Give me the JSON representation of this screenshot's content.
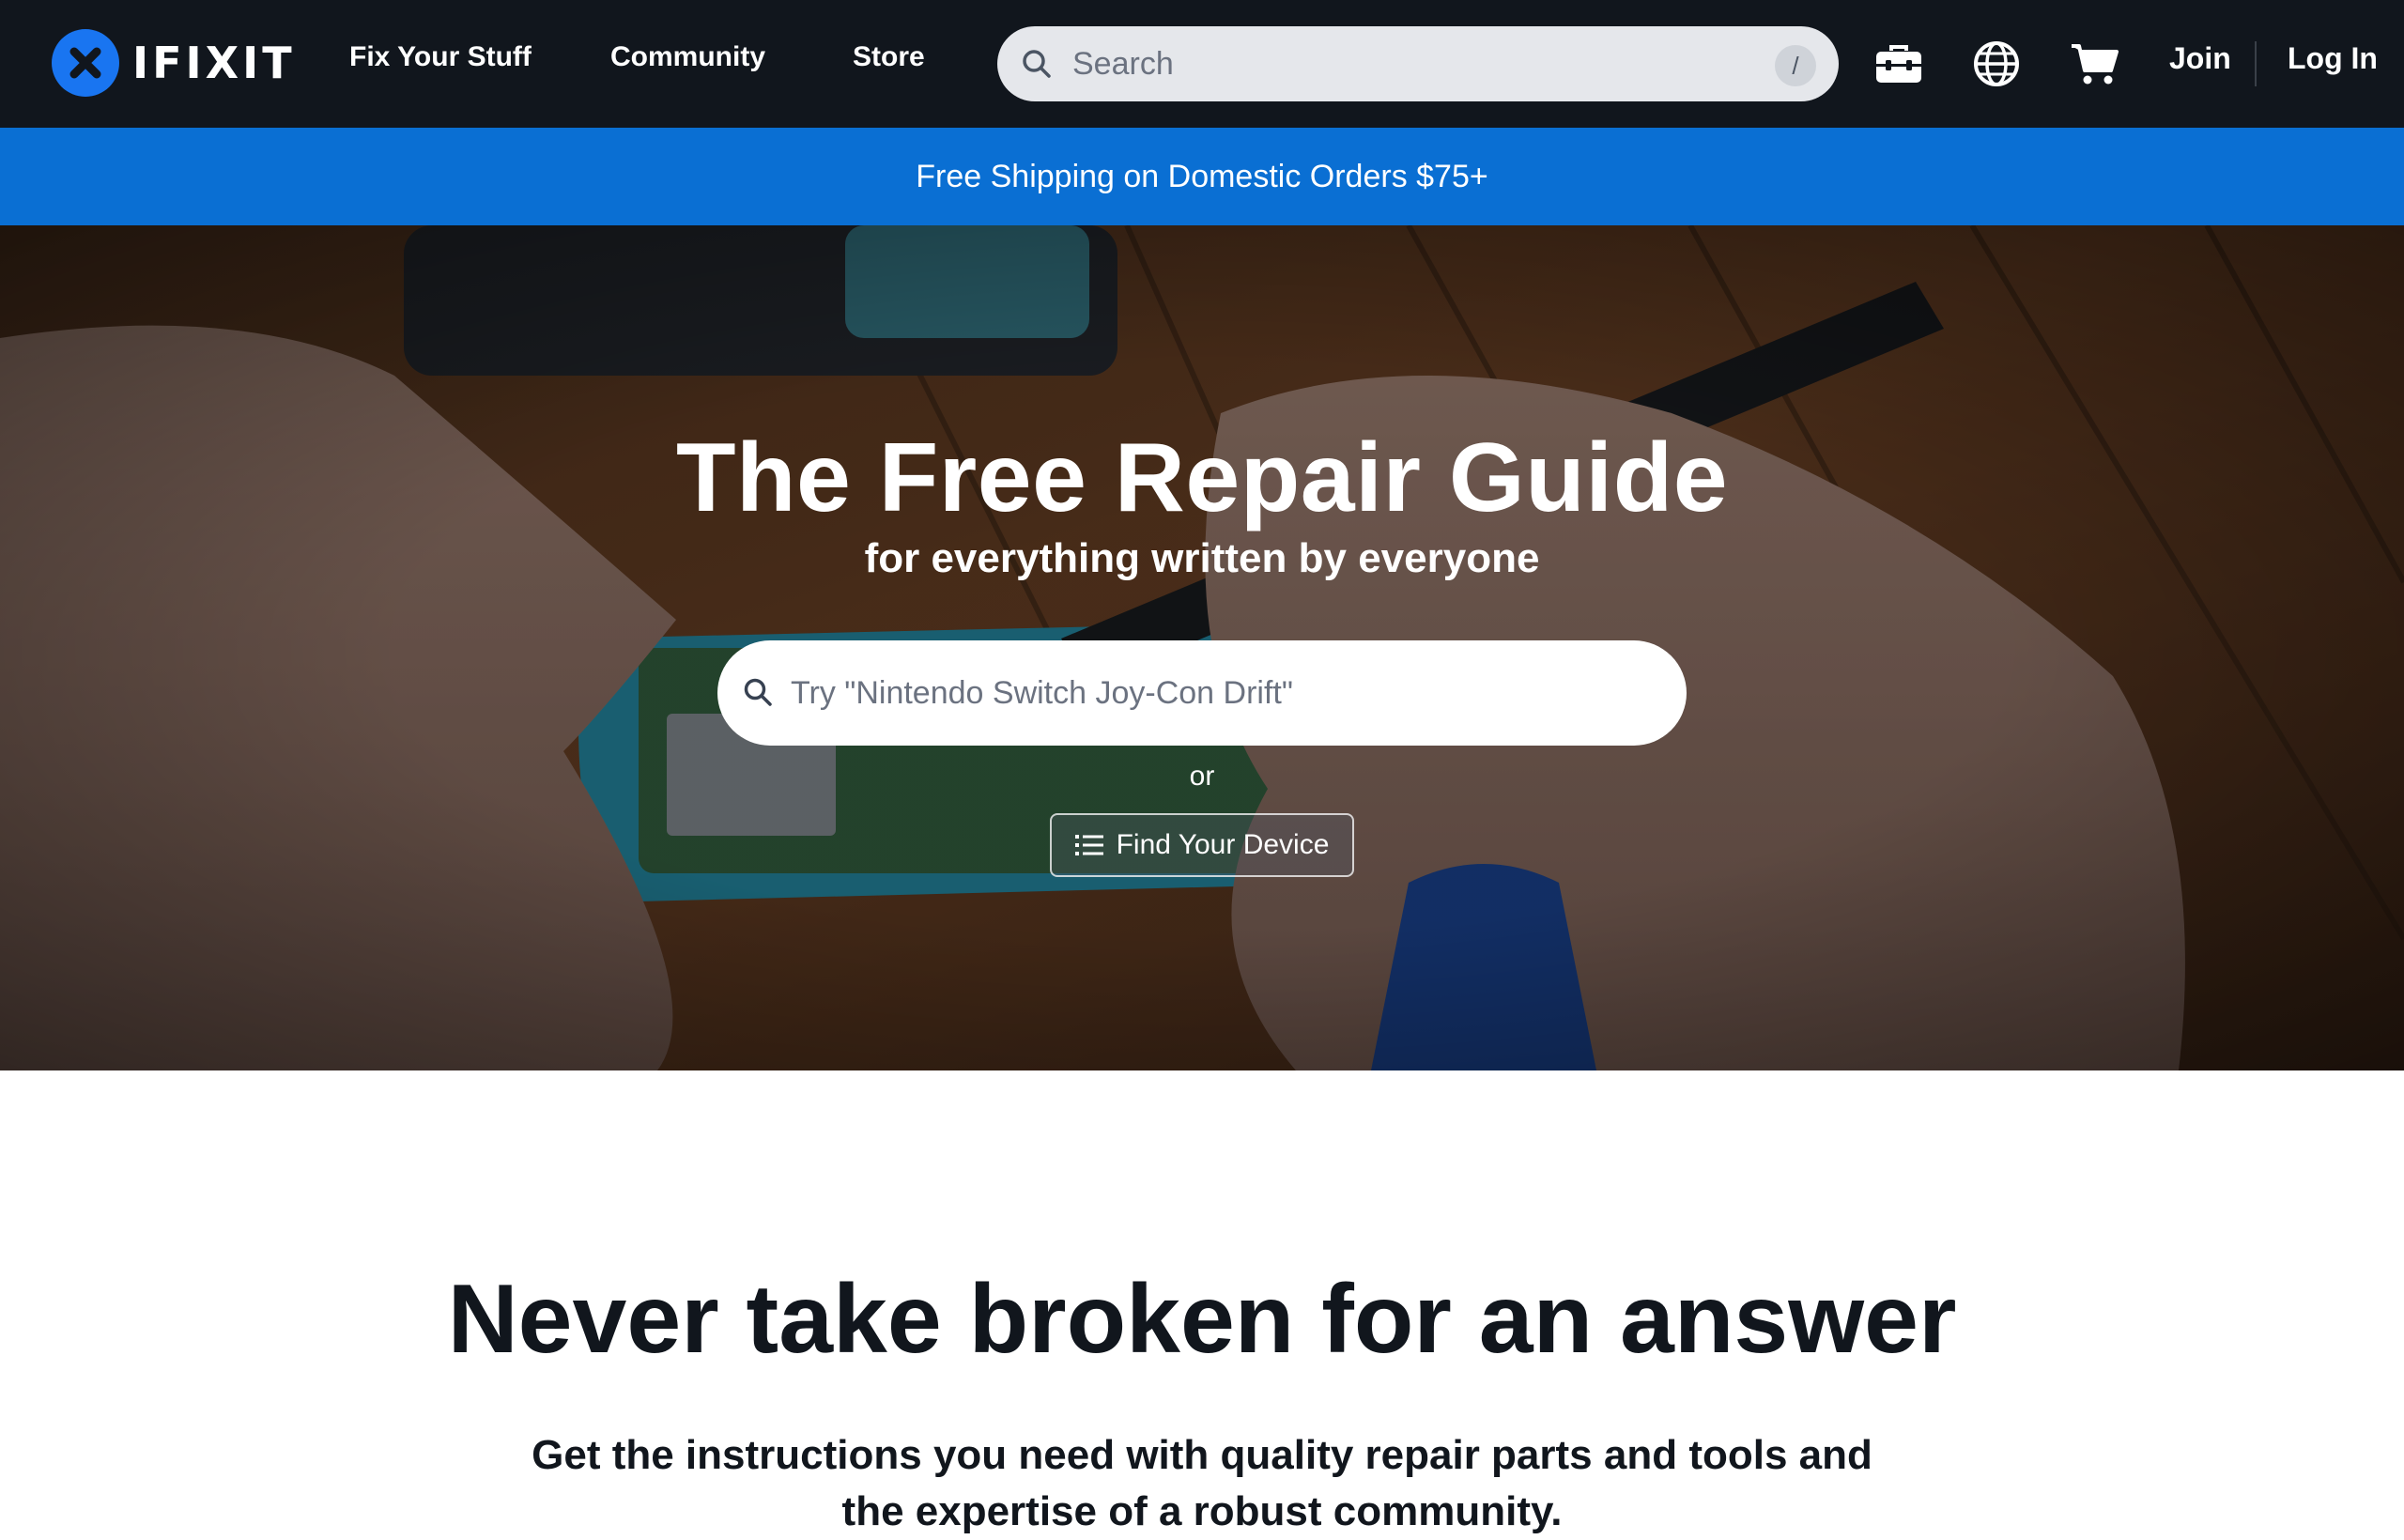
{
  "header": {
    "brand": "IFIXIT",
    "nav": [
      {
        "label": "Fix Your Stuff"
      },
      {
        "label": "Community"
      },
      {
        "label": "Store"
      }
    ],
    "search": {
      "placeholder": "Search",
      "shortcut": "/"
    },
    "icons": [
      "toolbox-icon",
      "globe-icon",
      "cart-icon"
    ],
    "join_label": "Join",
    "login_label": "Log In"
  },
  "promo": {
    "text": "Free Shipping on Domestic Orders $75+"
  },
  "hero": {
    "title": "The Free Repair Guide",
    "subtitle": "for everything written by everyone",
    "search_placeholder": "Try \"Nintendo Switch Joy-Con Drift\"",
    "or_text": "or",
    "find_device_label": "Find Your Device"
  },
  "intro": {
    "heading": "Never take broken for an answer",
    "lede": "Get the instructions you need with quality repair parts and tools and the expertise of a robust community."
  },
  "colors": {
    "navbar": "#11161d",
    "brand_blue": "#1975f1",
    "promo_blue": "#0a6fd3",
    "search_bg": "#e5e7eb"
  }
}
